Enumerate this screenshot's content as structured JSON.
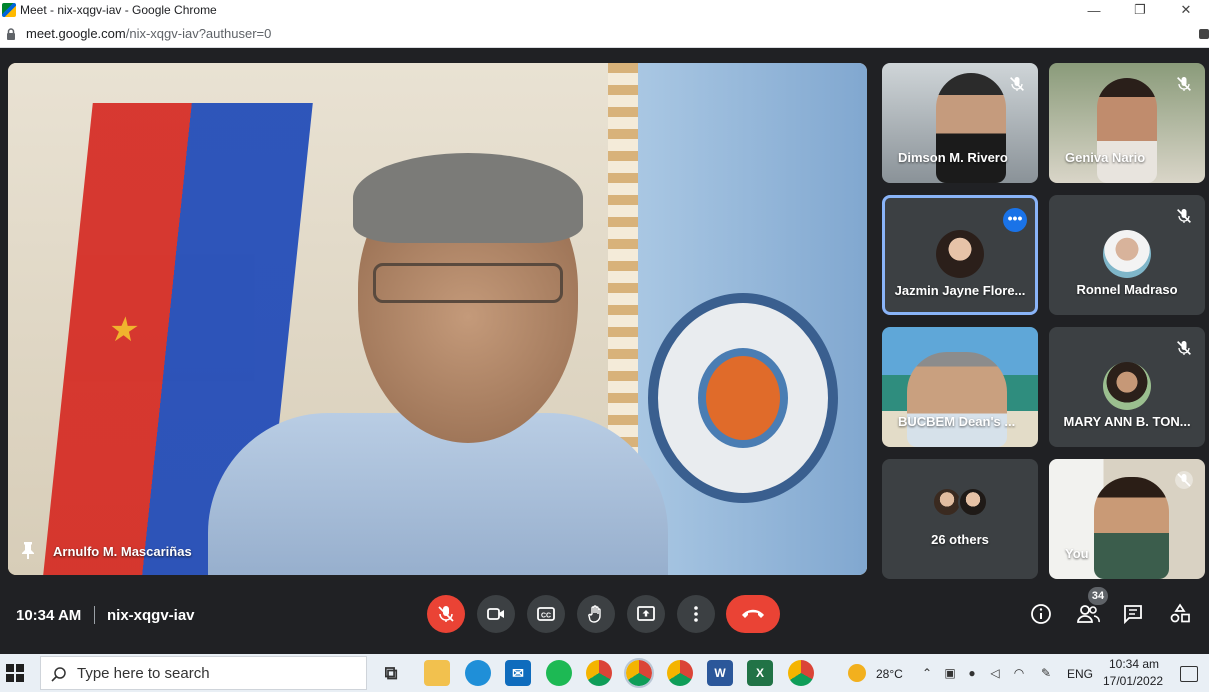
{
  "browser": {
    "window_title": "Meet - nix-xqgv-iav - Google Chrome",
    "url_host": "meet.google.com",
    "url_path": "/nix-xqgv-iav?authuser=0",
    "minimize_glyph": "—",
    "maximize_glyph": "❐",
    "close_glyph": "✕"
  },
  "main_speaker": {
    "name": "Arnulfo M. Mascariñas",
    "pinned": true
  },
  "participants": [
    {
      "name": "Dimson M. Rivero",
      "muted": true
    },
    {
      "name": "Geniva Nario",
      "muted": true
    },
    {
      "name": "Jazmin Jayne Flore...",
      "muted": false,
      "active": true
    },
    {
      "name": "Ronnel Madraso",
      "muted": true
    },
    {
      "name": "BUCBEM Dean's ...",
      "muted": false
    },
    {
      "name": "MARY ANN B. TON...",
      "muted": true
    },
    {
      "name": "26 others",
      "muted": false
    },
    {
      "name": "You",
      "muted": true
    }
  ],
  "meeting": {
    "time": "10:34 AM",
    "code": "nix-xqgv-iav",
    "participant_count": "34"
  },
  "controls": {
    "mic": "mic-off-icon",
    "camera": "camera-icon",
    "captions": "captions-icon",
    "raise_hand": "raise-hand-icon",
    "present": "present-icon",
    "more": "more-options-icon",
    "leave": "leave-call-icon",
    "info": "info-icon",
    "people": "people-icon",
    "chat": "chat-icon",
    "activities": "activities-icon"
  },
  "taskbar": {
    "search_placeholder": "Type here to search",
    "weather_temp": "28°C",
    "language": "ENG",
    "clock_time": "10:34 am",
    "clock_date": "17/01/2022"
  },
  "colors": {
    "meet_background": "#202124",
    "tile_background": "#3c4043",
    "danger": "#ea4335",
    "accent": "#8ab4f8",
    "accent_button": "#1a73e8"
  }
}
